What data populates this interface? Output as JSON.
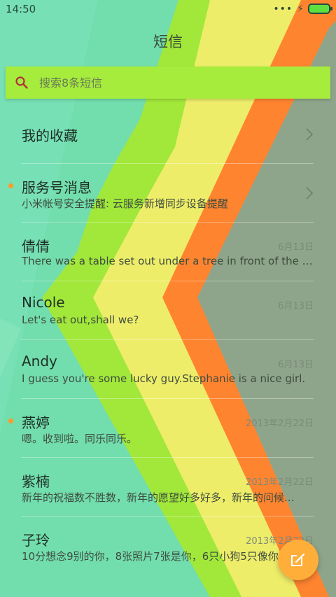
{
  "status_bar": {
    "time": "14:50",
    "dots": "•••",
    "charging": "⚡"
  },
  "header": {
    "title": "短信"
  },
  "search": {
    "placeholder": "搜索8条短信"
  },
  "colors": {
    "background": "#77e0b4",
    "search_bar": "#a6ec3c",
    "unread_dot": "#ff9a2a",
    "fab": "#ffae3a",
    "stripe_green": "#a2e83a",
    "stripe_yellow": "#eeed6a",
    "stripe_orange": "#ff8430",
    "stripe_gray": "#8fa58b"
  },
  "items": [
    {
      "name": "我的收藏",
      "preview": "",
      "date": "",
      "unread": false,
      "chevron": true
    },
    {
      "name": "服务号消息",
      "preview": "小米帐号安全提醒: 云服务新增同步设备提醒",
      "date": "",
      "unread": true,
      "chevron": true
    },
    {
      "name": "倩倩",
      "preview": "There was a table set out under a tree in front of the ho...",
      "date": "6月13日",
      "unread": false,
      "chevron": false
    },
    {
      "name": "Nicole",
      "preview": "Let's eat out,shall we?",
      "date": "6月13日",
      "unread": false,
      "chevron": false
    },
    {
      "name": "Andy",
      "preview": "I guess you're some lucky guy.Stephanie is a nice girl.",
      "date": "6月13日",
      "unread": false,
      "chevron": false
    },
    {
      "name": "燕婷",
      "preview": "嗯。收到啦。同乐同乐。",
      "date": "2013年2月22日",
      "unread": true,
      "chevron": false
    },
    {
      "name": "紫楠",
      "preview": "新年的祝福数不胜数，新年的愿望好多好多，新年的问候...",
      "date": "2013年2月22日",
      "unread": false,
      "chevron": false
    },
    {
      "name": "子玲",
      "preview": "10分想念9别的你，8张照片7张是你，6只小狗5只像你",
      "date": "2013年2月22日",
      "unread": false,
      "chevron": false
    }
  ],
  "fab": {
    "icon": "compose-icon"
  }
}
